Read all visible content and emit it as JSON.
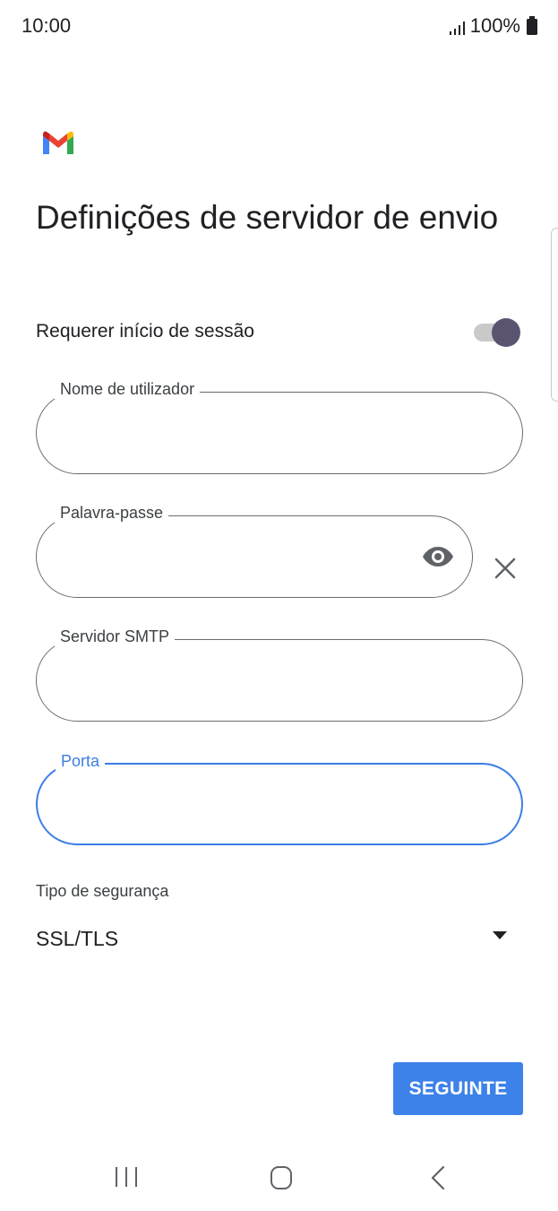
{
  "status_bar": {
    "time": "10:00",
    "battery_text": "100%"
  },
  "header": {
    "app_logo": "gmail-logo",
    "title": "Definições de servidor de envio"
  },
  "form": {
    "require_signin": {
      "label": "Requerer início de sessão",
      "enabled": true
    },
    "username": {
      "label": "Nome de utilizador",
      "value": ""
    },
    "password": {
      "label": "Palavra-passe",
      "value": "",
      "toggle_icon": "eye-icon",
      "clear_icon": "close-icon"
    },
    "smtp_server": {
      "label": "Servidor SMTP",
      "value": ""
    },
    "port": {
      "label": "Porta",
      "value": "",
      "focused": true
    },
    "security_type": {
      "label": "Tipo de segurança",
      "value": "SSL/TLS"
    }
  },
  "actions": {
    "next_label": "SEGUINTE"
  },
  "colors": {
    "accent": "#3d82e8",
    "focus_border": "#3c7ee4",
    "toggle_thumb": "#5a5471"
  },
  "nav": {
    "recent_icon": "recent-apps-icon",
    "home_icon": "home-icon",
    "back_icon": "back-icon"
  }
}
